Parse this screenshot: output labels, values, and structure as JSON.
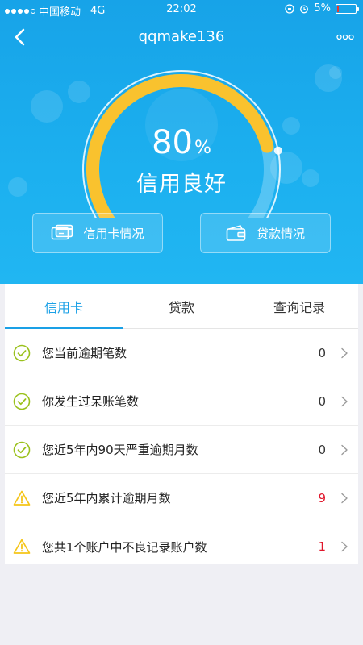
{
  "status_bar": {
    "carrier": "中国移动",
    "network": "4G",
    "time": "22:02",
    "battery": "5%"
  },
  "nav": {
    "title": "qqmake136",
    "back_icon": "chevron-left-icon",
    "more_icon": "more-dots-icon"
  },
  "score": {
    "value": "80",
    "unit": "%",
    "level": 0.8,
    "status": "信用良好",
    "colors": {
      "arc": "#f9c22e",
      "track": "rgba(255,255,255,0.25)"
    }
  },
  "quick_actions": [
    {
      "label": "信用卡情况",
      "icon": "credit-card-icon"
    },
    {
      "label": "贷款情况",
      "icon": "wallet-icon"
    }
  ],
  "tabs": [
    {
      "label": "信用卡",
      "active": true
    },
    {
      "label": "贷款",
      "active": false
    },
    {
      "label": "查询记录",
      "active": false
    }
  ],
  "records": [
    {
      "label": "您当前逾期笔数",
      "value": "0",
      "status": "ok"
    },
    {
      "label": "你发生过呆账笔数",
      "value": "0",
      "status": "ok"
    },
    {
      "label": "您近5年内90天严重逾期月数",
      "value": "0",
      "status": "ok"
    },
    {
      "label": "您近5年内累计逾期月数",
      "value": "9",
      "status": "warn"
    },
    {
      "label": "您共1个账户中不良记录账户数",
      "value": "1",
      "status": "warn"
    }
  ],
  "colors": {
    "accent": "#1aa0e6",
    "ok": "#9ac11c",
    "warn_icon": "#f5c518",
    "warn_value": "#e0162b"
  }
}
